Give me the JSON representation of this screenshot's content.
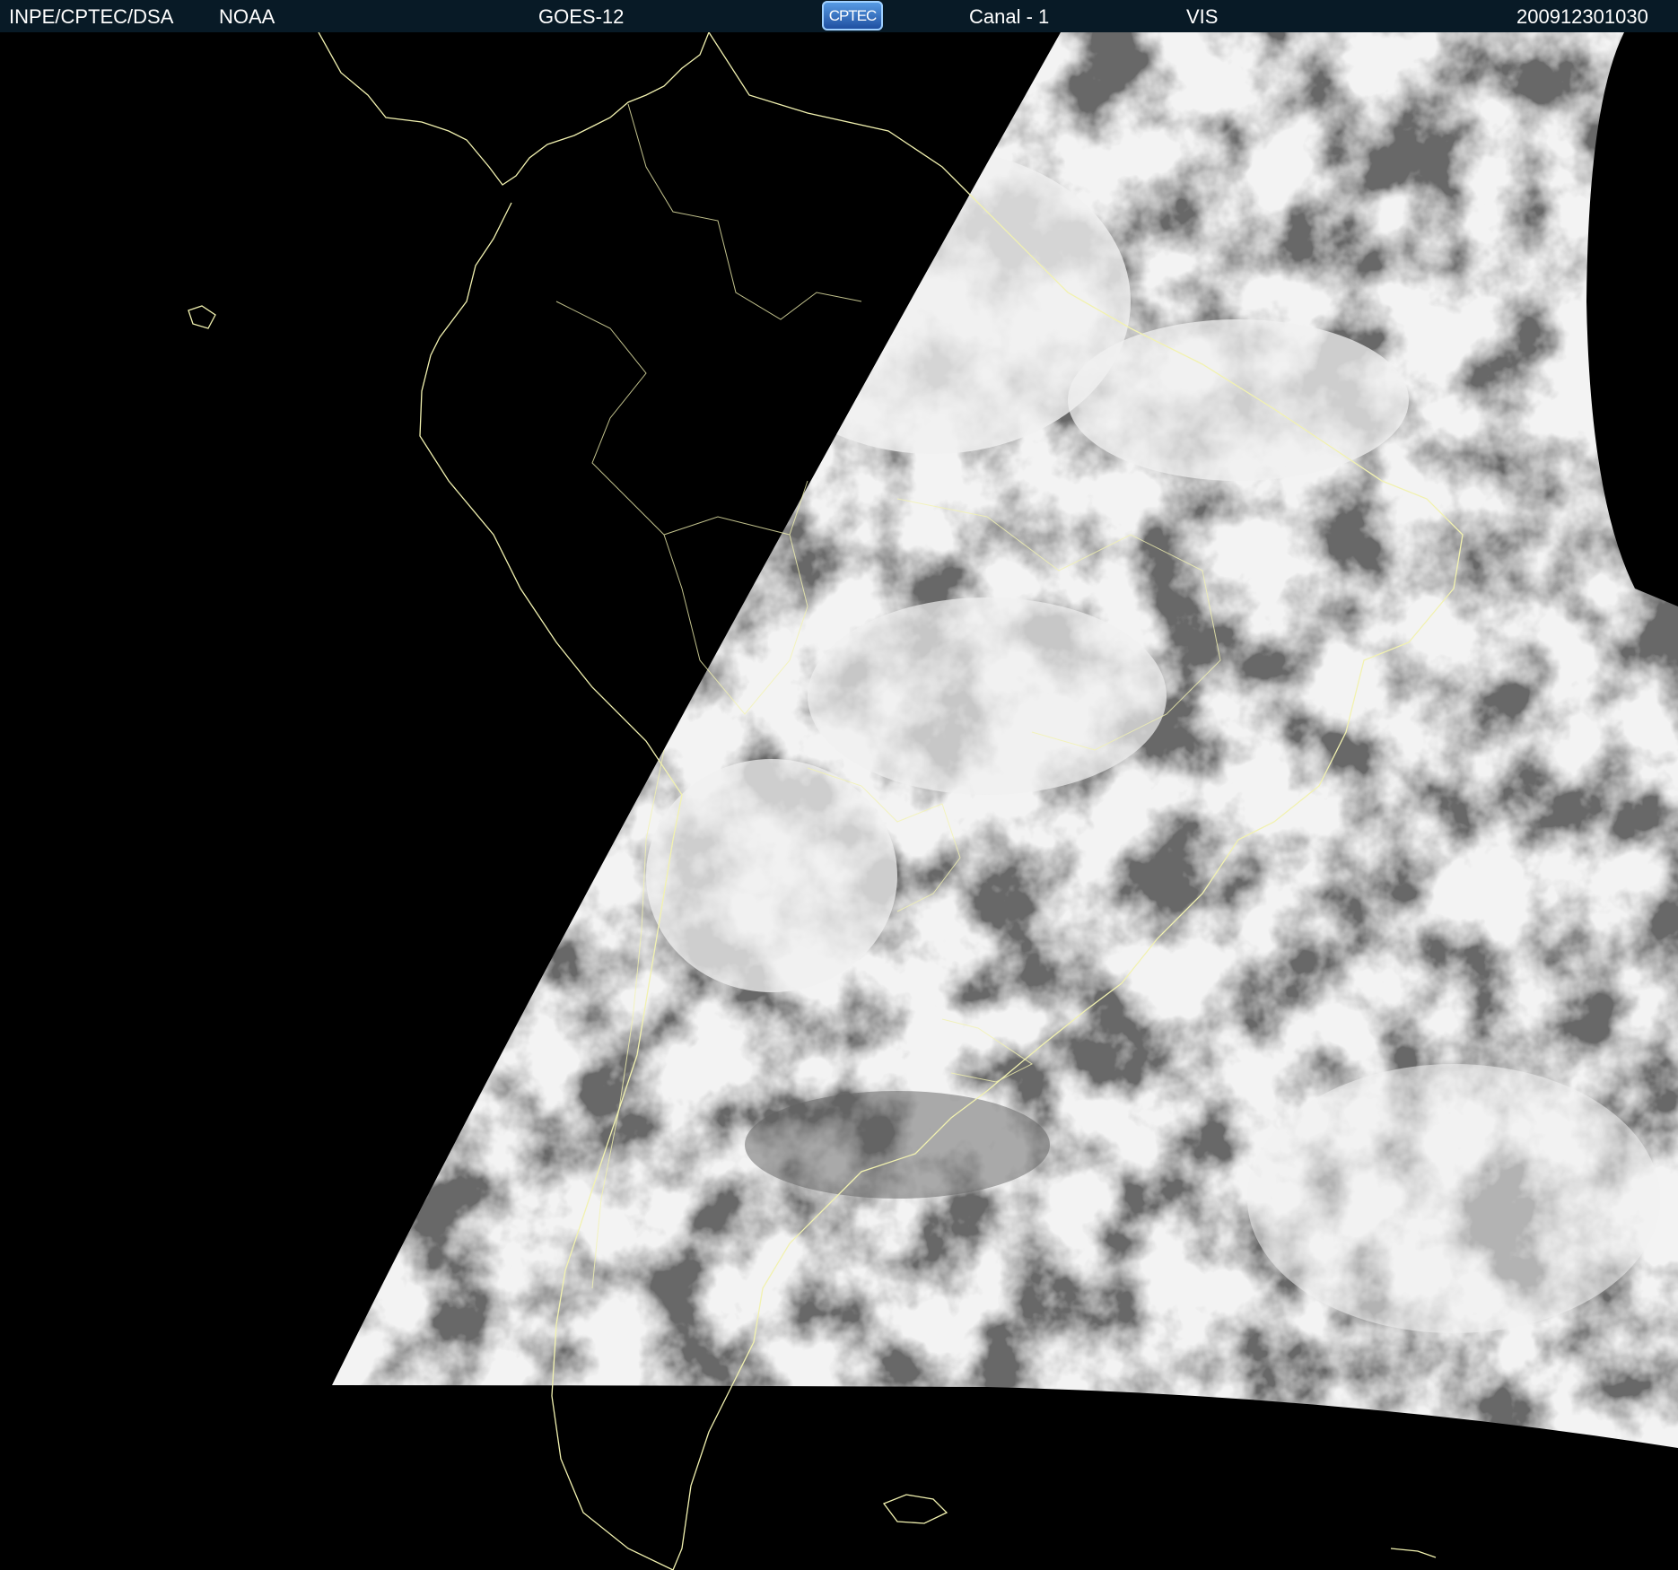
{
  "header": {
    "institution": "INPE/CPTEC/DSA",
    "agency": "NOAA",
    "satellite": "GOES-12",
    "logo_text": "CPTEC",
    "channel": "Canal - 1",
    "band": "VIS",
    "datetime": "200912301030"
  },
  "colors": {
    "header_bg": "#081a26",
    "space_bg": "#000000",
    "coastline": "#f2f2b0",
    "cloud_bright": "#f0f0f0",
    "cloud_gray": "#6a6a6a"
  }
}
